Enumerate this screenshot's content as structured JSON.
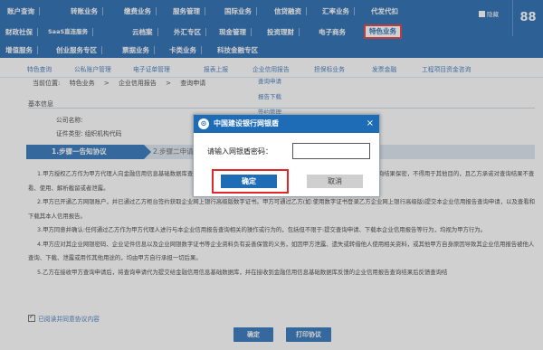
{
  "nav": {
    "row1": [
      "账户查询",
      "转账业务",
      "缴费业务",
      "服务管理",
      "国际业务",
      "信贷融资",
      "汇率业务",
      "代发代扣"
    ],
    "row2": [
      "财政社保",
      "SaaS直连服务",
      "云档案",
      "外汇专区",
      "现金管理",
      "投资理财",
      "电子商务",
      "特色业务"
    ],
    "row3": [
      "增值服务",
      "创业服务专区",
      "票据业务",
      "卡类业务",
      "科技金融专区"
    ],
    "collapse": "隐藏",
    "grid_icon": "88"
  },
  "subnav": {
    "items": [
      "特色查询",
      "公私账户管理",
      "电子证单管理",
      "报表上报",
      "企业信用报告",
      "担保标业务",
      "发票金融",
      "工程项目资金咨询"
    ],
    "dropdown": [
      "查询申请",
      "报告下载",
      "签约管理"
    ]
  },
  "breadcrumb": {
    "label": "当前位置:",
    "items": [
      "特色业务",
      "企业信用报告",
      "查询申请"
    ]
  },
  "basic_info": {
    "title": "基本信息",
    "company_label": "公司名称:",
    "id_type": "证件类型: 组织机构代码"
  },
  "steps": {
    "step1": "1.步骤一告知协议",
    "step2": "2.步骤二申请信息"
  },
  "agreement": [
    "1.甲方授权乙方作为甲方代理人向金融信用信息基础数据库查询甲方信用报告，并向甲方反馈查询结果；乙方应当保证依法对反馈的查询结果保密，不得用于其他目的，且乙方承诺对查询结果不查看、使用、解析截留或者泄露。",
    "2.甲方已开通乙方网银账户，并已通过乙方柜台签约获取企业网上银行高级版数字证书。甲方可通过乙方(如:使用数字证书登录乙方企业网上银行高级版)提交本企业信用报告查询申请，以及查看和下载其本人信用报告。",
    "3.甲方同意并确认:任何通过乙方作为甲方代理人进行与本企业信用报告查询相关的操作或行为的，包括但不限于:提交查询申请、下载本企业信用报告等行为，均视为甲方行为。",
    "4.甲方应对其企业网银密码、企业证件信息以及企业网银数字证书等企业资料负有妥善保管的义务，如因甲方泄露、遗失或转借他人使用相关资料，或其他甲方自身原因导致其企业信用报告被他人查询、下载、泄露或用作其他用途的，均由甲方自行承担一切后果。",
    "5.乙方在接收甲方查询申请后，将查询申请代为提交给金融信用信息基础数据库，并在接收到金融信用信息基础数据库反馈的企业信用报告查询结果后反馈查询结"
  ],
  "agree_text": "已阅读并同意协议内容",
  "buttons": {
    "confirm": "确定",
    "print": "打印协议"
  },
  "modal": {
    "title": "中国建设银行网银盾",
    "prompt": "请输入网银盾密码：",
    "password_value": "",
    "ok": "确定",
    "cancel": "取消",
    "close_icon": "×"
  },
  "colors": {
    "nav_blue": "#0f5aa8",
    "highlight_red": "#e02828",
    "link_blue": "#2f6db5"
  }
}
